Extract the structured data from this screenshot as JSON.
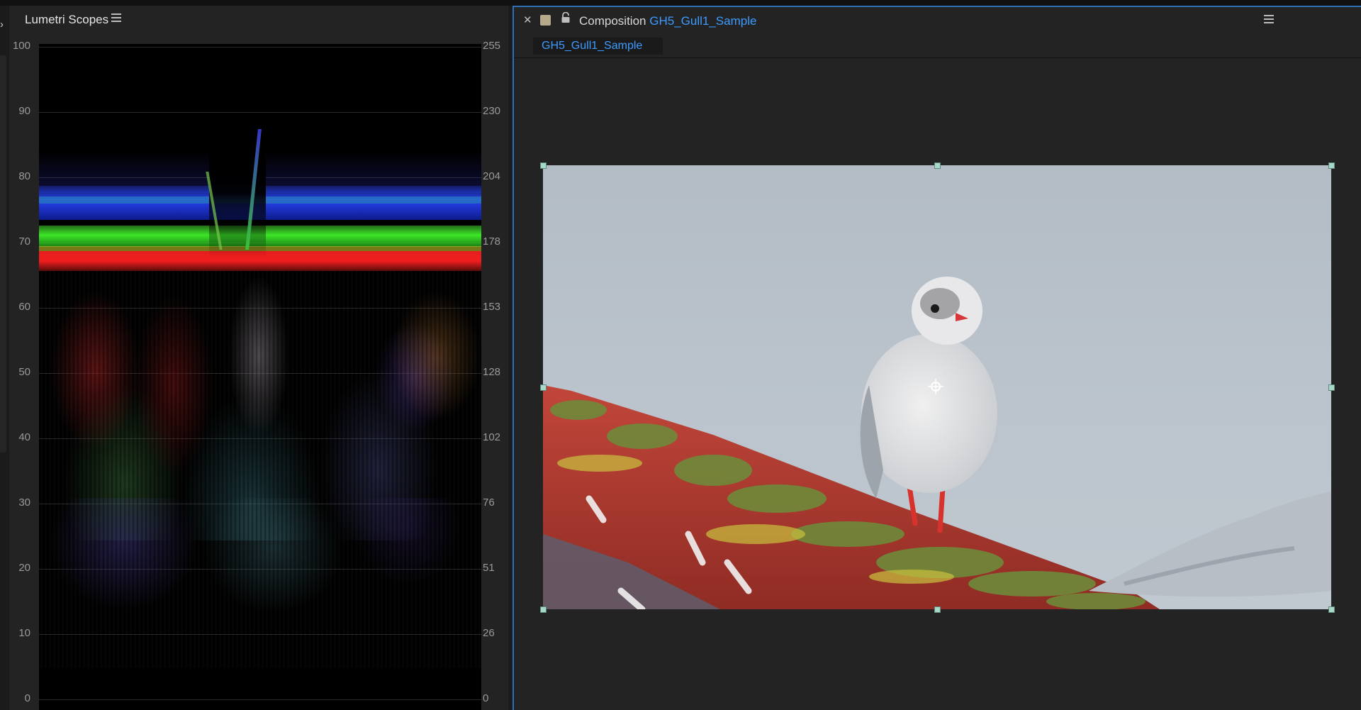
{
  "lumetri": {
    "title": "Lumetri Scopes",
    "left_axis": [
      "100",
      "90",
      "80",
      "70",
      "60",
      "50",
      "40",
      "30",
      "20",
      "10",
      "0"
    ],
    "right_axis": [
      "255",
      "230",
      "204",
      "178",
      "153",
      "128",
      "102",
      "76",
      "51",
      "26",
      "0"
    ]
  },
  "composition": {
    "prefix": "Composition",
    "name": "GH5_Gull1_Sample",
    "tab": "GH5_Gull1_Sample"
  },
  "icons": {
    "expand": "chevron-right-icon",
    "menu": "hamburger-menu-icon",
    "close": "close-icon",
    "lock": "lock-icon",
    "anchor": "anchor-point-icon"
  },
  "colors": {
    "accent": "#3d9bff",
    "panel": "#232323",
    "label_swatch": "#b7a98b"
  }
}
